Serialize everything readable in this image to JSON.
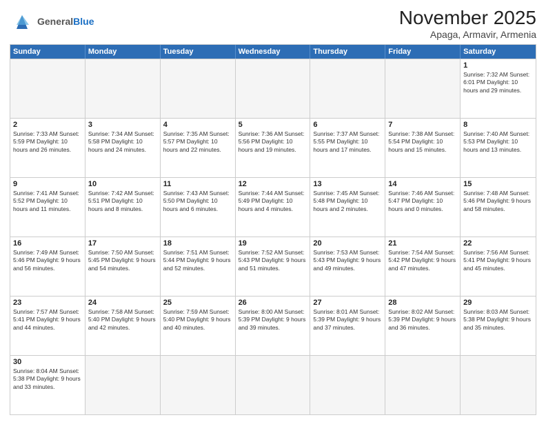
{
  "header": {
    "logo_general": "General",
    "logo_blue": "Blue",
    "month_title": "November 2025",
    "location": "Apaga, Armavir, Armenia"
  },
  "days_of_week": [
    "Sunday",
    "Monday",
    "Tuesday",
    "Wednesday",
    "Thursday",
    "Friday",
    "Saturday"
  ],
  "weeks": [
    [
      {
        "day": "",
        "info": ""
      },
      {
        "day": "",
        "info": ""
      },
      {
        "day": "",
        "info": ""
      },
      {
        "day": "",
        "info": ""
      },
      {
        "day": "",
        "info": ""
      },
      {
        "day": "",
        "info": ""
      },
      {
        "day": "1",
        "info": "Sunrise: 7:32 AM\nSunset: 6:01 PM\nDaylight: 10 hours and 29 minutes."
      }
    ],
    [
      {
        "day": "2",
        "info": "Sunrise: 7:33 AM\nSunset: 5:59 PM\nDaylight: 10 hours and 26 minutes."
      },
      {
        "day": "3",
        "info": "Sunrise: 7:34 AM\nSunset: 5:58 PM\nDaylight: 10 hours and 24 minutes."
      },
      {
        "day": "4",
        "info": "Sunrise: 7:35 AM\nSunset: 5:57 PM\nDaylight: 10 hours and 22 minutes."
      },
      {
        "day": "5",
        "info": "Sunrise: 7:36 AM\nSunset: 5:56 PM\nDaylight: 10 hours and 19 minutes."
      },
      {
        "day": "6",
        "info": "Sunrise: 7:37 AM\nSunset: 5:55 PM\nDaylight: 10 hours and 17 minutes."
      },
      {
        "day": "7",
        "info": "Sunrise: 7:38 AM\nSunset: 5:54 PM\nDaylight: 10 hours and 15 minutes."
      },
      {
        "day": "8",
        "info": "Sunrise: 7:40 AM\nSunset: 5:53 PM\nDaylight: 10 hours and 13 minutes."
      }
    ],
    [
      {
        "day": "9",
        "info": "Sunrise: 7:41 AM\nSunset: 5:52 PM\nDaylight: 10 hours and 11 minutes."
      },
      {
        "day": "10",
        "info": "Sunrise: 7:42 AM\nSunset: 5:51 PM\nDaylight: 10 hours and 8 minutes."
      },
      {
        "day": "11",
        "info": "Sunrise: 7:43 AM\nSunset: 5:50 PM\nDaylight: 10 hours and 6 minutes."
      },
      {
        "day": "12",
        "info": "Sunrise: 7:44 AM\nSunset: 5:49 PM\nDaylight: 10 hours and 4 minutes."
      },
      {
        "day": "13",
        "info": "Sunrise: 7:45 AM\nSunset: 5:48 PM\nDaylight: 10 hours and 2 minutes."
      },
      {
        "day": "14",
        "info": "Sunrise: 7:46 AM\nSunset: 5:47 PM\nDaylight: 10 hours and 0 minutes."
      },
      {
        "day": "15",
        "info": "Sunrise: 7:48 AM\nSunset: 5:46 PM\nDaylight: 9 hours and 58 minutes."
      }
    ],
    [
      {
        "day": "16",
        "info": "Sunrise: 7:49 AM\nSunset: 5:46 PM\nDaylight: 9 hours and 56 minutes."
      },
      {
        "day": "17",
        "info": "Sunrise: 7:50 AM\nSunset: 5:45 PM\nDaylight: 9 hours and 54 minutes."
      },
      {
        "day": "18",
        "info": "Sunrise: 7:51 AM\nSunset: 5:44 PM\nDaylight: 9 hours and 52 minutes."
      },
      {
        "day": "19",
        "info": "Sunrise: 7:52 AM\nSunset: 5:43 PM\nDaylight: 9 hours and 51 minutes."
      },
      {
        "day": "20",
        "info": "Sunrise: 7:53 AM\nSunset: 5:43 PM\nDaylight: 9 hours and 49 minutes."
      },
      {
        "day": "21",
        "info": "Sunrise: 7:54 AM\nSunset: 5:42 PM\nDaylight: 9 hours and 47 minutes."
      },
      {
        "day": "22",
        "info": "Sunrise: 7:56 AM\nSunset: 5:41 PM\nDaylight: 9 hours and 45 minutes."
      }
    ],
    [
      {
        "day": "23",
        "info": "Sunrise: 7:57 AM\nSunset: 5:41 PM\nDaylight: 9 hours and 44 minutes."
      },
      {
        "day": "24",
        "info": "Sunrise: 7:58 AM\nSunset: 5:40 PM\nDaylight: 9 hours and 42 minutes."
      },
      {
        "day": "25",
        "info": "Sunrise: 7:59 AM\nSunset: 5:40 PM\nDaylight: 9 hours and 40 minutes."
      },
      {
        "day": "26",
        "info": "Sunrise: 8:00 AM\nSunset: 5:39 PM\nDaylight: 9 hours and 39 minutes."
      },
      {
        "day": "27",
        "info": "Sunrise: 8:01 AM\nSunset: 5:39 PM\nDaylight: 9 hours and 37 minutes."
      },
      {
        "day": "28",
        "info": "Sunrise: 8:02 AM\nSunset: 5:39 PM\nDaylight: 9 hours and 36 minutes."
      },
      {
        "day": "29",
        "info": "Sunrise: 8:03 AM\nSunset: 5:38 PM\nDaylight: 9 hours and 35 minutes."
      }
    ],
    [
      {
        "day": "30",
        "info": "Sunrise: 8:04 AM\nSunset: 5:38 PM\nDaylight: 9 hours and 33 minutes."
      },
      {
        "day": "",
        "info": ""
      },
      {
        "day": "",
        "info": ""
      },
      {
        "day": "",
        "info": ""
      },
      {
        "day": "",
        "info": ""
      },
      {
        "day": "",
        "info": ""
      },
      {
        "day": "",
        "info": ""
      }
    ]
  ]
}
